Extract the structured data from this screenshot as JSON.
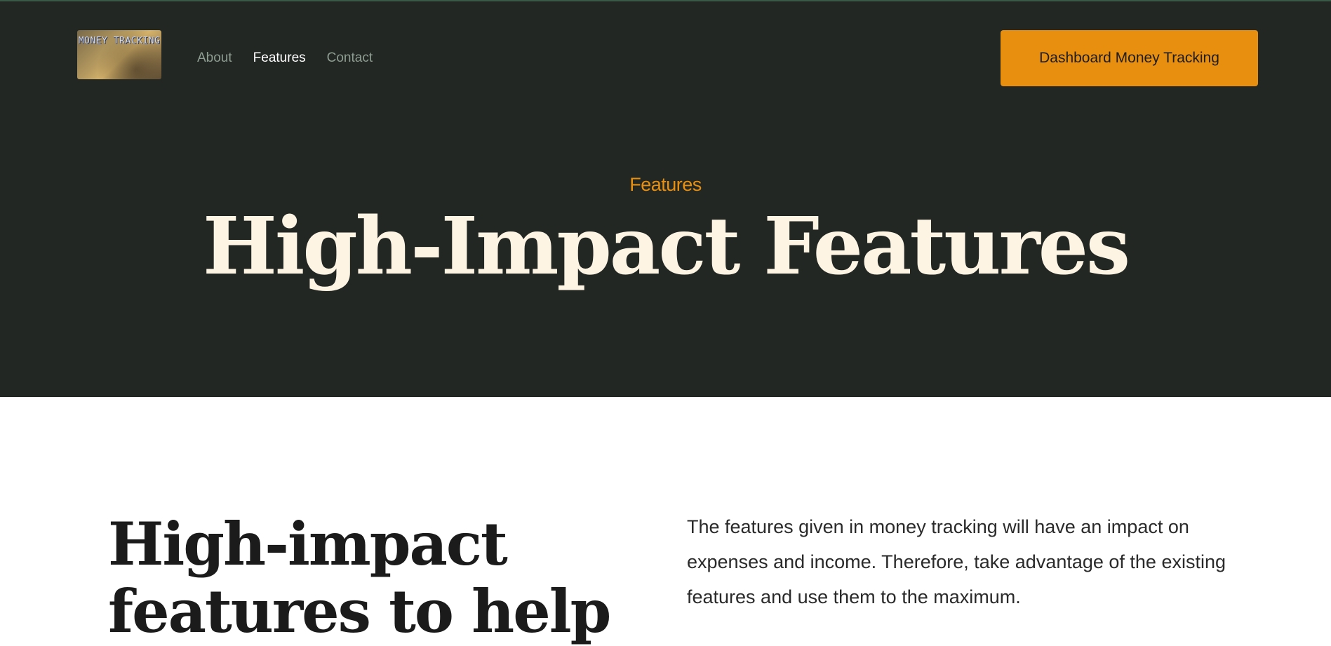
{
  "header": {
    "logo_text": "MONEY TRACKING",
    "nav": [
      {
        "label": "About",
        "active": false
      },
      {
        "label": "Features",
        "active": true
      },
      {
        "label": "Contact",
        "active": false
      }
    ],
    "cta_label": "Dashboard Money Tracking"
  },
  "hero": {
    "eyebrow": "Features",
    "title": "High-Impact Features"
  },
  "intro": {
    "title": "High-impact features to help",
    "body": "The features given in money tracking will have an impact on expenses and income. Therefore, take advantage of the existing features and use them to the maximum."
  },
  "colors": {
    "hero_bg": "#222723",
    "accent": "#e88f10",
    "hero_title": "#fdf4e4",
    "nav_inactive": "#8e9d92",
    "nav_active": "#ffffff"
  }
}
